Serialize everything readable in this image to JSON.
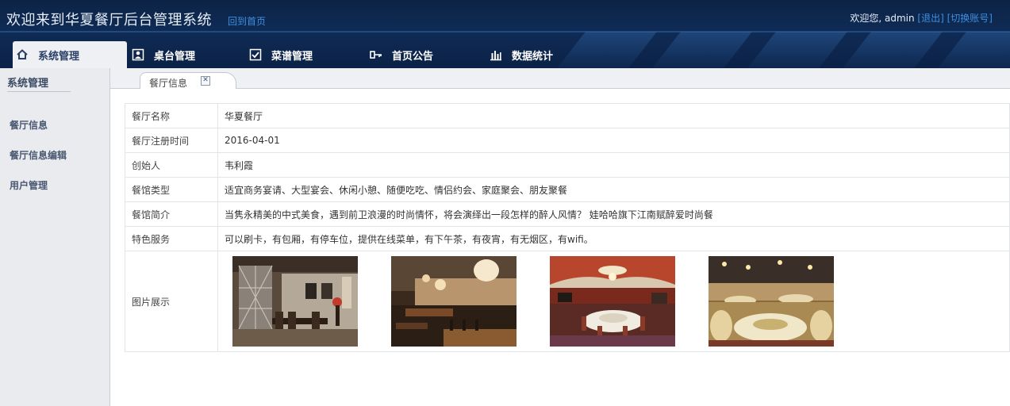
{
  "header": {
    "title": "欢迎来到华夏餐厅后台管理系统",
    "home_link": "回到首页",
    "greeting": "欢迎您, admin",
    "logout": "[退出]",
    "switch_account": "[切换账号]"
  },
  "nav": [
    {
      "label": "系统管理",
      "icon": "home-icon",
      "active": true
    },
    {
      "label": "桌台管理",
      "icon": "user-card-icon"
    },
    {
      "label": "菜谱管理",
      "icon": "checklist-icon"
    },
    {
      "label": "首页公告",
      "icon": "key-icon"
    },
    {
      "label": "数据统计",
      "icon": "bar-chart-icon"
    }
  ],
  "sidebar": {
    "title": "系统管理",
    "items": [
      "餐厅信息",
      "餐厅信息编辑",
      "用户管理"
    ]
  },
  "tab": {
    "label": "餐厅信息",
    "close": "✕"
  },
  "info": {
    "rows": [
      {
        "key": "餐厅名称",
        "value": "华夏餐厅"
      },
      {
        "key": "餐厅注册时间",
        "value": "2016-04-01"
      },
      {
        "key": "创始人",
        "value": "韦利霞"
      },
      {
        "key": "餐馆类型",
        "value": "适宜商务宴请、大型宴会、休闲小憩、随便吃吃、情侣约会、家庭聚会、朋友聚餐"
      },
      {
        "key": "餐馆简介",
        "value": "当隽永精美的中式美食，遇到前卫浪漫的时尚情怀，将会演绎出一段怎样的醉人风情？ 娃哈哈旗下江南赋醉爱时尚餐"
      },
      {
        "key": "特色服务",
        "value": "可以刷卡，有包厢，有停车位，提供在线菜单，有下午茶，有夜宵，有无烟区，有wifi。"
      }
    ],
    "photos_key": "图片展示"
  },
  "colors": {
    "header_bg": "#0f2b55",
    "link": "#3d8fe0",
    "sidebar_bg": "#e9ebef"
  }
}
